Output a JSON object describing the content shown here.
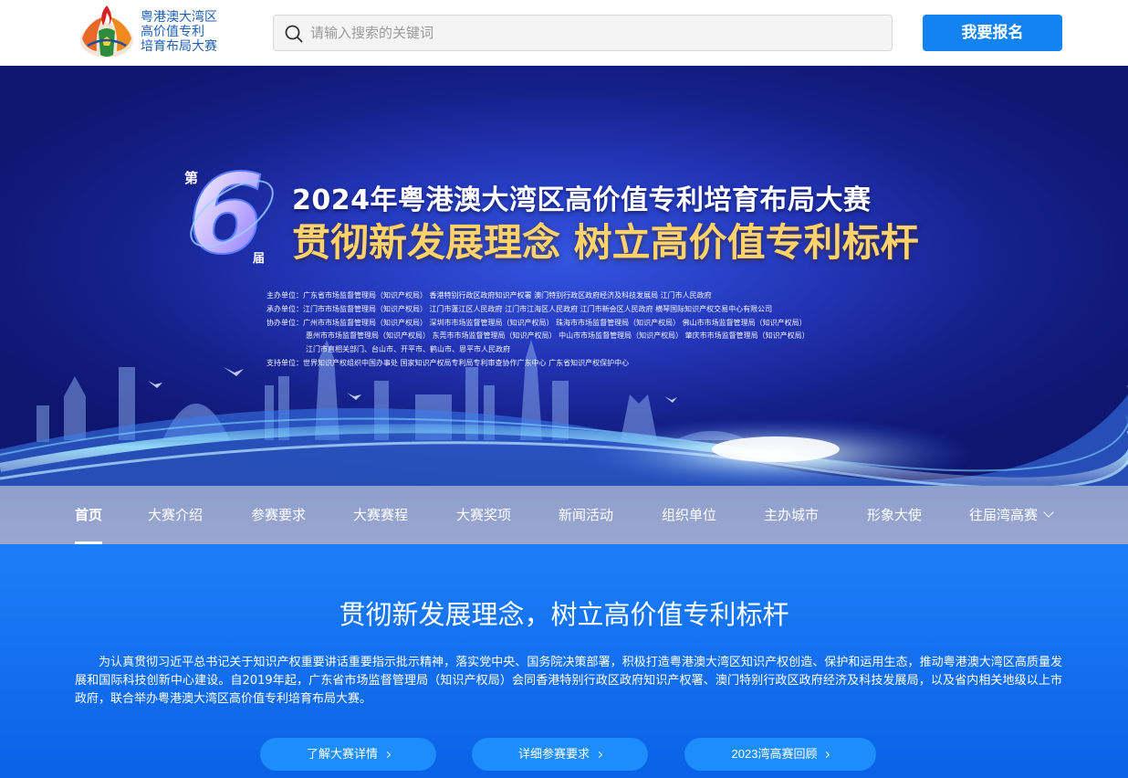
{
  "header": {
    "logo_lines": [
      "粤港澳大湾区",
      "高价值专利",
      "培育布局大赛"
    ],
    "search_placeholder": "请输入搜索的关键词",
    "signup_label": "我要报名"
  },
  "banner": {
    "edition_pre": "第",
    "edition_num": "6",
    "edition_post": "届",
    "title": "2024年粤港澳大湾区高价值专利培育布局大赛",
    "slogan": "贯彻新发展理念 树立高价值专利标杆",
    "organizers": [
      "主办单位：广东省市场监督管理局（知识产权局）  香港特别行政区政府知识产权署  澳门特别行政区政府经济及科技发展局  江门市人民政府",
      "承办单位：江门市市场监督管理局（知识产权局）  江门市蓬江区人民政府  江门市江海区人民政府  江门市新会区人民政府  横琴国际知识产权交易中心有限公司",
      "协办单位：广州市市场监督管理局（知识产权局）  深圳市市场监督管理局（知识产权局）  珠海市市场监督管理局（知识产权局）  佛山市市场监督管理局（知识产权局）",
      "惠州市市场监督管理局（知识产权局）  东莞市市场监督管理局（知识产权局）  中山市市场监督管理局（知识产权局）  肇庆市市场监督管理局（知识产权局）",
      "江门市直相关部门、台山市、开平市、鹤山市、恩平市人民政府",
      "支持单位：世界知识产权组织中国办事处  国家知识产权局专利局专利审查协作广东中心  广东省知识产权保护中心"
    ]
  },
  "nav": {
    "items": [
      {
        "label": "首页",
        "active": true
      },
      {
        "label": "大赛介绍"
      },
      {
        "label": "参赛要求"
      },
      {
        "label": "大赛赛程"
      },
      {
        "label": "大赛奖项"
      },
      {
        "label": "新闻活动"
      },
      {
        "label": "组织单位"
      },
      {
        "label": "主办城市"
      },
      {
        "label": "形象大使"
      },
      {
        "label": "往届湾高赛"
      }
    ]
  },
  "intro": {
    "heading": "贯彻新发展理念，树立高价值专利标杆",
    "body": "为认真贯彻习近平总书记关于知识产权重要讲话重要指示批示精神，落实党中央、国务院决策部署，积极打造粤港澳大湾区知识产权创造、保护和运用生态，推动粤港澳大湾区高质量发展和国际科技创新中心建设。自2019年起，广东省市场监督管理局（知识产权局）会同香港特别行政区政府知识产权署、澳门特别行政区政府经济及科技发展局，以及省内相关地级以上市政府，联合举办粤港澳大湾区高价值专利培育布局大赛。",
    "buttons": [
      "了解大赛详情",
      "详细参赛要求",
      "2023湾高赛回顾"
    ]
  },
  "colors": {
    "brand_blue": "#1483f2",
    "banner_blue": "#2336b8",
    "nav_bg": "#96a3cf",
    "intro_bg": "#1475f0"
  },
  "icons": [
    "torch-logo-icon",
    "search-icon",
    "chevron-down-icon",
    "chevron-right-icon"
  ]
}
